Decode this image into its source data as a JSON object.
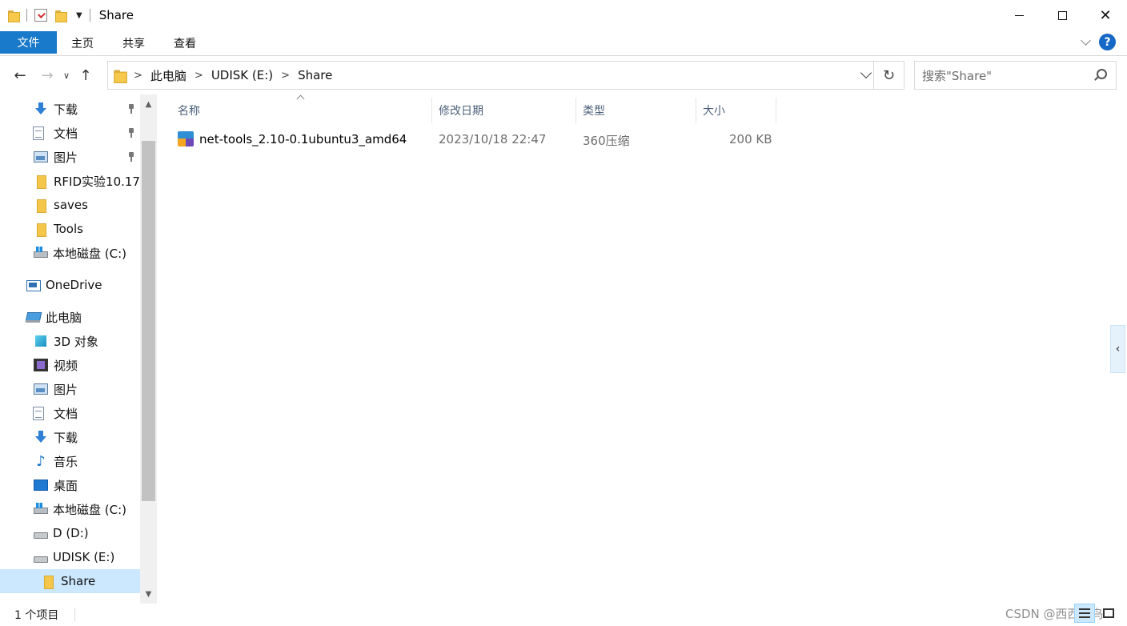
{
  "window": {
    "title": "Share"
  },
  "ribbon": {
    "tabs": [
      {
        "label": "文件"
      },
      {
        "label": "主页"
      },
      {
        "label": "共享"
      },
      {
        "label": "查看"
      }
    ]
  },
  "address": {
    "crumbs": [
      "此电脑",
      "UDISK (E:)",
      "Share"
    ]
  },
  "search": {
    "placeholder": "搜索\"Share\""
  },
  "sidebar": {
    "items": [
      {
        "label": "下载",
        "icon": "download-icon",
        "pinned": true
      },
      {
        "label": "文档",
        "icon": "document-icon",
        "pinned": true
      },
      {
        "label": "图片",
        "icon": "picture-icon",
        "pinned": true
      },
      {
        "label": "RFID实验10.17",
        "icon": "folder-icon"
      },
      {
        "label": "saves",
        "icon": "folder-icon"
      },
      {
        "label": "Tools",
        "icon": "folder-icon"
      },
      {
        "label": "本地磁盘 (C:)",
        "icon": "system-drive-icon"
      },
      {
        "label": "OneDrive",
        "icon": "onedrive-icon"
      },
      {
        "label": "此电脑",
        "icon": "this-pc-icon"
      },
      {
        "label": "3D 对象",
        "icon": "3d-objects-icon"
      },
      {
        "label": "视频",
        "icon": "video-icon"
      },
      {
        "label": "图片",
        "icon": "picture-icon"
      },
      {
        "label": "文档",
        "icon": "document-icon"
      },
      {
        "label": "下载",
        "icon": "download-icon"
      },
      {
        "label": "音乐",
        "icon": "music-icon"
      },
      {
        "label": "桌面",
        "icon": "desktop-icon"
      },
      {
        "label": "本地磁盘 (C:)",
        "icon": "system-drive-icon"
      },
      {
        "label": "D (D:)",
        "icon": "drive-icon"
      },
      {
        "label": "UDISK (E:)",
        "icon": "drive-icon"
      },
      {
        "label": "Share",
        "icon": "folder-icon",
        "selected": true
      }
    ]
  },
  "columns": {
    "name": "名称",
    "modified": "修改日期",
    "type": "类型",
    "size": "大小"
  },
  "files": [
    {
      "name": "net-tools_2.10-0.1ubuntu3_amd64",
      "modified": "2023/10/18 22:47",
      "type": "360压缩",
      "size": "200 KB"
    }
  ],
  "status": {
    "count": "1 个项目"
  },
  "watermark": "CSDN @西西菜鸟",
  "colors": {
    "accent": "#1979ca",
    "selection": "#cce8ff",
    "column_header_text": "#4c607a"
  }
}
